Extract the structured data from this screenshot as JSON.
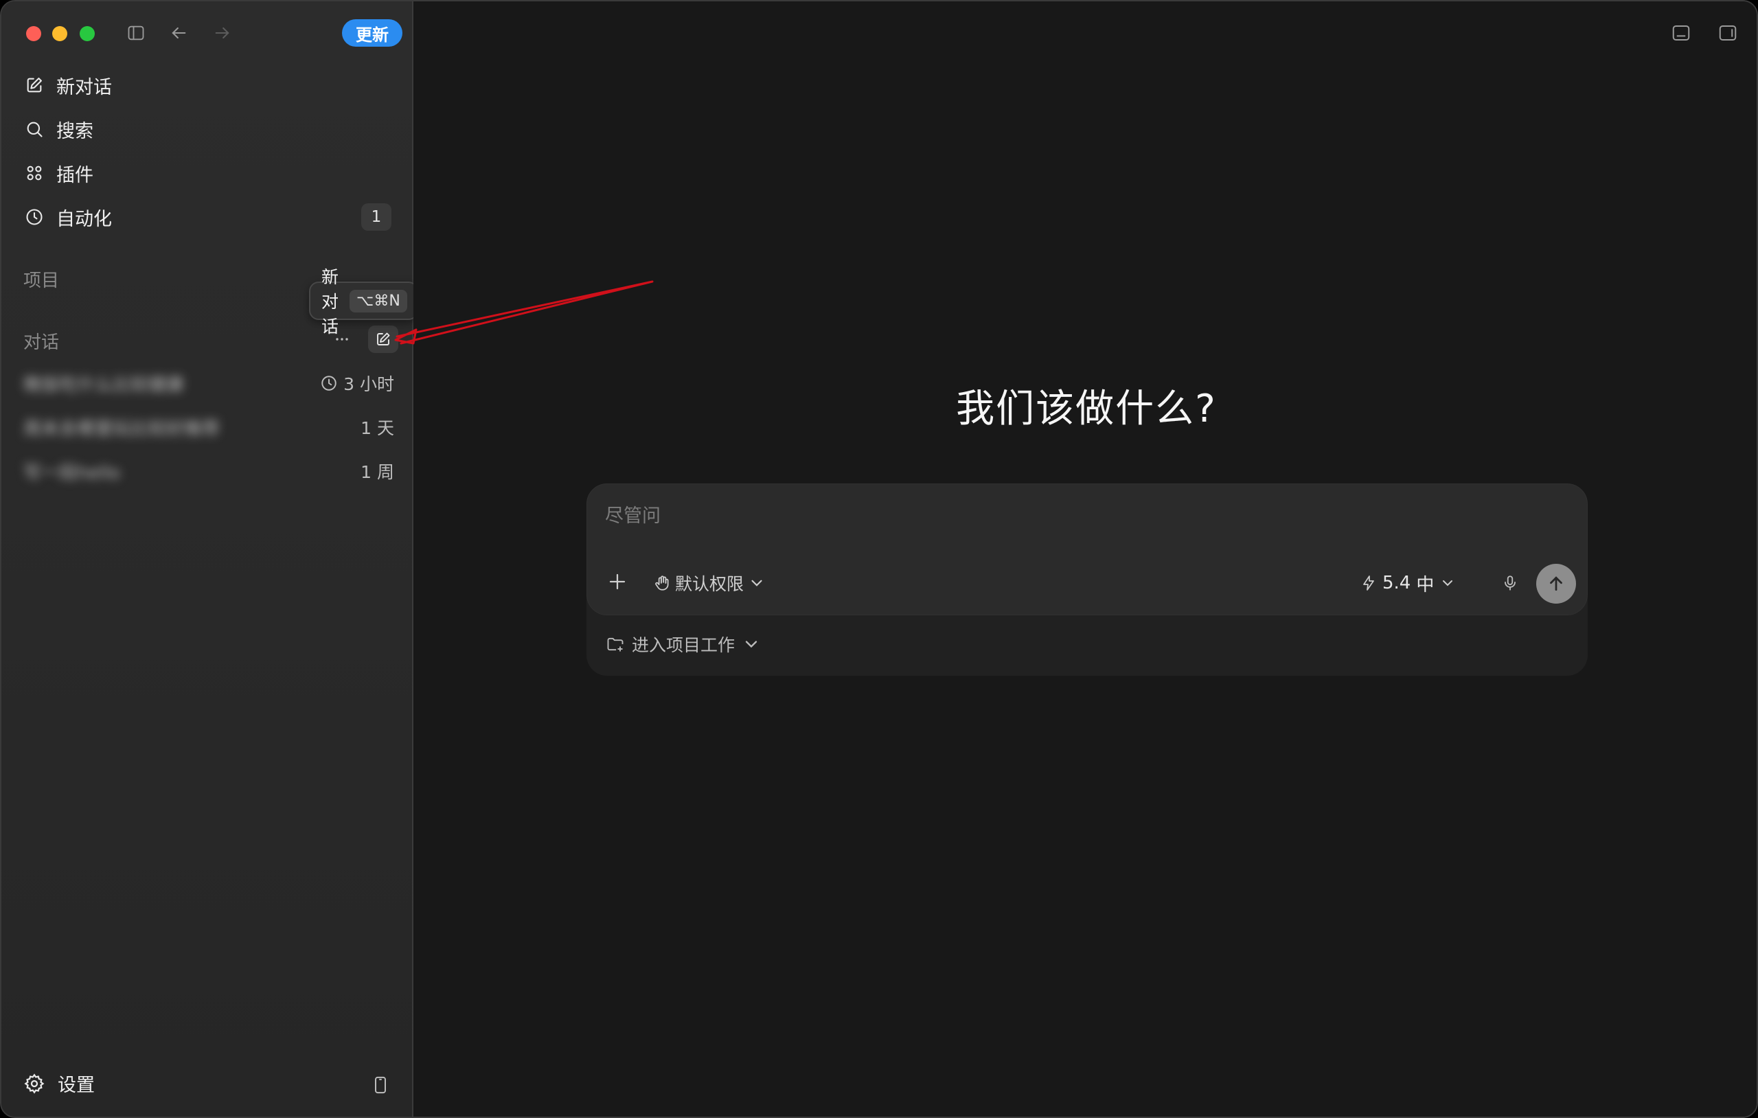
{
  "titlebar": {
    "update_label": "更新"
  },
  "sidebar": {
    "nav": [
      {
        "label": "新对话",
        "icon": "edit-icon"
      },
      {
        "label": "搜索",
        "icon": "search-icon"
      },
      {
        "label": "插件",
        "icon": "grid-icon"
      },
      {
        "label": "自动化",
        "icon": "clock-icon",
        "badge": "1"
      }
    ],
    "projects_title": "项目",
    "conversations_title": "对话",
    "conversations": [
      {
        "title": "晚饭吃什么比较健康",
        "time": "3 小时"
      },
      {
        "title": "周末去哪里玩比较好推荐",
        "time": "1 天"
      },
      {
        "title": "写一段hello",
        "time": "1 周"
      }
    ],
    "tooltip": {
      "label": "新对话",
      "shortcut": "⌥⌘N"
    },
    "settings_label": "设置"
  },
  "main": {
    "headline": "我们该做什么?",
    "composer": {
      "placeholder": "尽管问",
      "permission_label": "默认权限",
      "model_version": "5.4",
      "model_effort": "中",
      "project_label": "进入项目工作"
    }
  },
  "colors": {
    "accent": "#2b8cf0",
    "annotation_arrow": "#d0101a"
  }
}
